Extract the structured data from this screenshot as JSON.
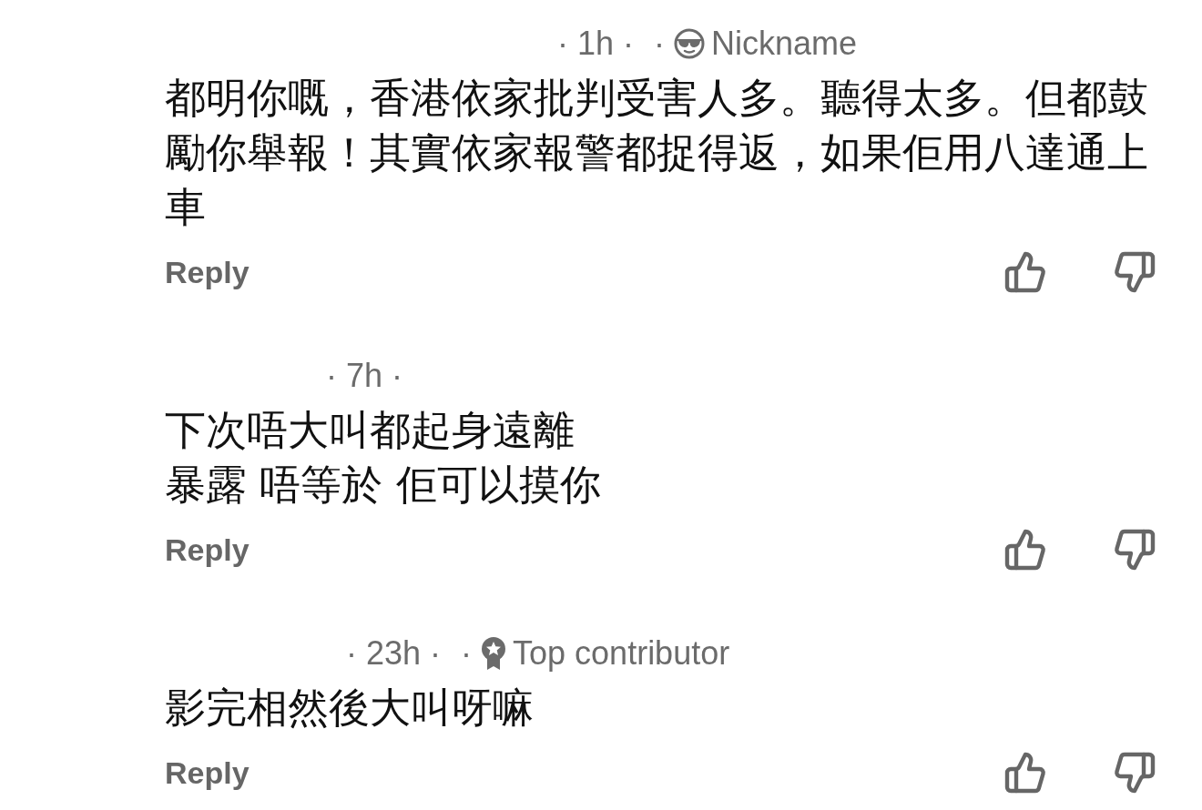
{
  "comments": [
    {
      "meta": {
        "time": "· 1h ·",
        "badge": {
          "kind": "nickname",
          "dot": "·",
          "label": "Nickname"
        }
      },
      "lines": [
        "都明你嘅，香港依家批判受害人多。聽得太多。但都鼓勵你舉報！其實依家報警都捉得返，如果佢用八達通上車"
      ],
      "reply": "Reply"
    },
    {
      "meta": {
        "time": "· 7h ·"
      },
      "lines": [
        "下次唔大叫都起身遠離",
        "暴露 唔等於 佢可以摸你"
      ],
      "reply": "Reply"
    },
    {
      "meta": {
        "time": "· 23h ·",
        "badge": {
          "kind": "top_contributor",
          "dot": "·",
          "label": "Top contributor"
        }
      },
      "lines": [
        "影完相然後大叫呀嘛"
      ],
      "reply": "Reply"
    }
  ]
}
